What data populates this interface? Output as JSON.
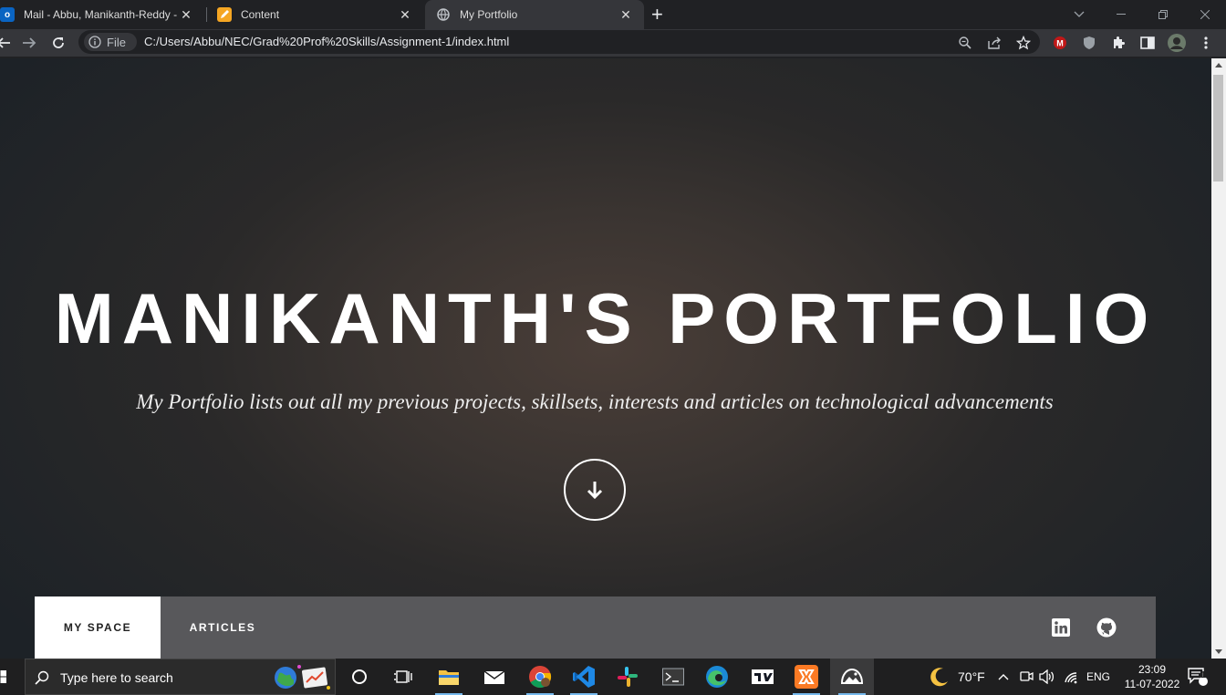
{
  "browser": {
    "tabs": [
      {
        "title": "Mail - Abbu, Manikanth-Reddy -",
        "favicon": "outlook-icon"
      },
      {
        "title": "Content",
        "favicon": "pencil-icon"
      },
      {
        "title": "My Portfolio",
        "favicon": "globe-icon"
      }
    ],
    "new_tab": "+",
    "security_label": "File",
    "url": "C:/Users/Abbu/NEC/Grad%20Prof%20Skills/Assignment-1/index.html"
  },
  "hero": {
    "title": "MANIKANTH'S PORTFOLIO",
    "subtitle": "My Portfolio lists out all my previous projects, skillsets, interests and articles on technological advancements"
  },
  "nav": {
    "items": [
      {
        "label": "MY SPACE",
        "active": true
      },
      {
        "label": "ARTICLES",
        "active": false
      }
    ],
    "social": [
      "linkedin-icon",
      "github-icon"
    ]
  },
  "taskbar": {
    "search_placeholder": "Type here to search",
    "weather": "70°F",
    "language": "ENG",
    "time": "23:09",
    "date": "11-07-2022",
    "notifications": "1"
  },
  "colors": {
    "accent_nav_active_bg": "#ffffff",
    "nav_bg": "#58585b",
    "taskbar_bg": "#1f1f20"
  }
}
